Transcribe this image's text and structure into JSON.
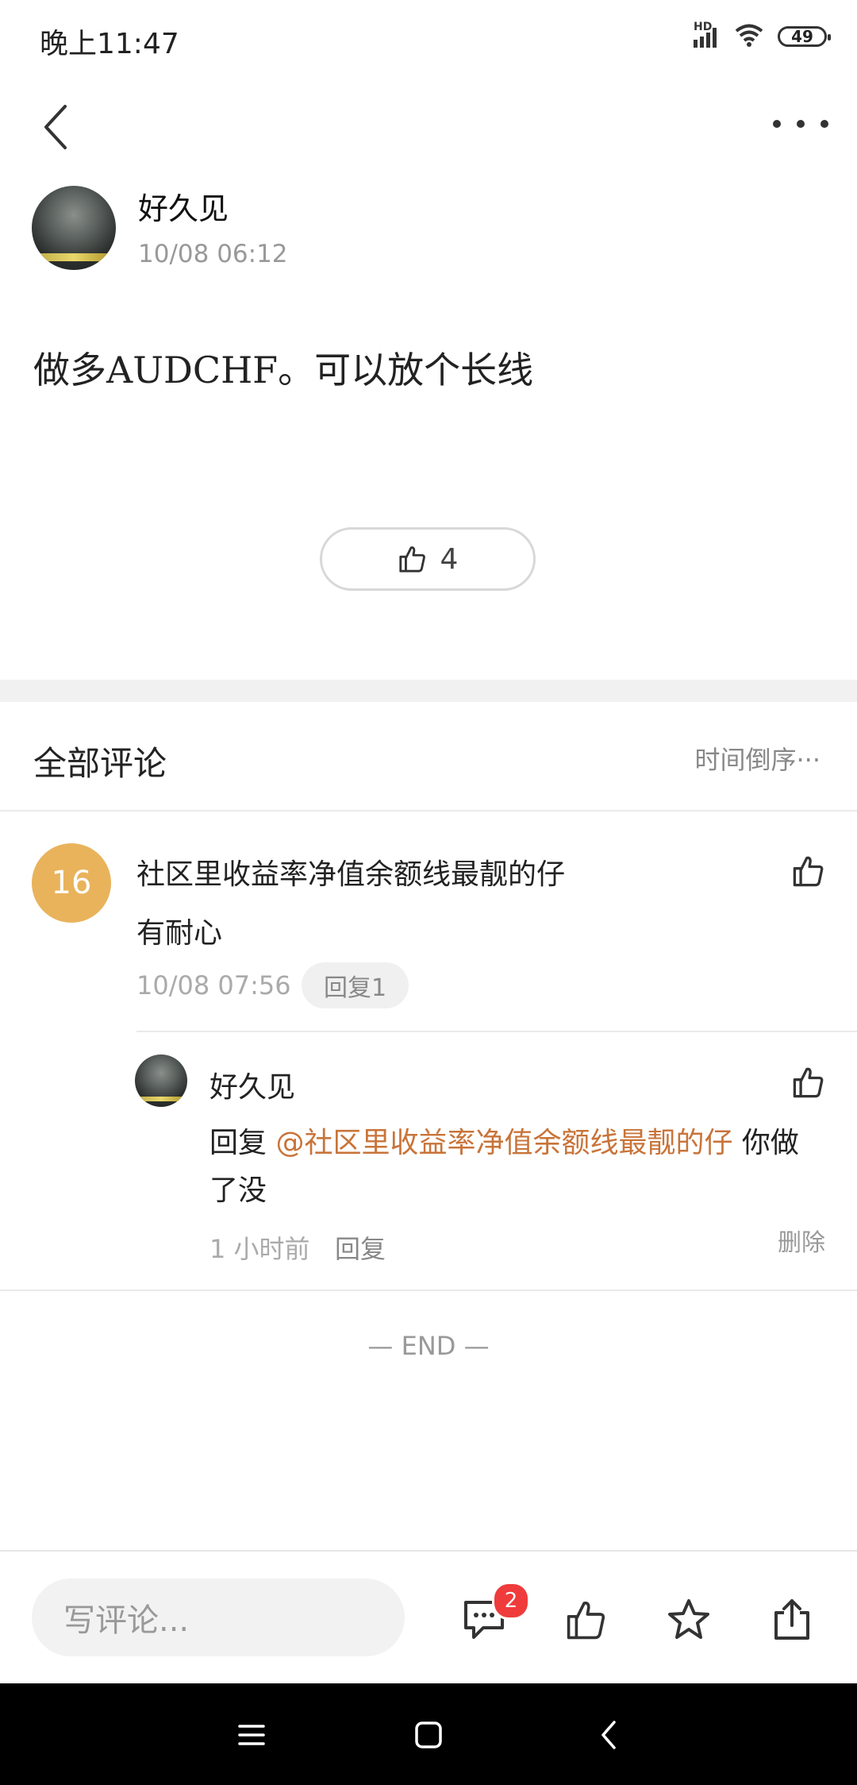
{
  "status_bar": {
    "time": "晚上11:47",
    "network": "HD",
    "battery": "49"
  },
  "post": {
    "author": "好久见",
    "time": "10/08 06:12",
    "content": "做多AUDCHF。可以放个长线",
    "likes": "4"
  },
  "comments_section": {
    "title": "全部评论",
    "sort_label": "时间倒序",
    "comments": [
      {
        "avatar_text": "16",
        "name": "社区里收益率净值余额线最靓的仔",
        "text": "有耐心",
        "time": "10/08 07:56",
        "reply_count_label": "回复1",
        "replies": [
          {
            "name": "好久见",
            "prefix": "回复 ",
            "mention": "@社区里收益率净值余额线最靓的仔",
            "text": " 你做了没",
            "time": "1 小时前",
            "reply_label": "回复",
            "delete_label": "删除"
          }
        ]
      }
    ]
  },
  "end_marker": "— END —",
  "bottom_bar": {
    "input_placeholder": "写评论...",
    "comment_badge": "2",
    "icons": [
      "comment-icon",
      "thumbs-up-icon",
      "star-icon",
      "share-icon"
    ]
  },
  "colors": {
    "accent": "#c8743a",
    "badge": "#ef3b3b",
    "avatar_bg": "#e9b35c"
  }
}
